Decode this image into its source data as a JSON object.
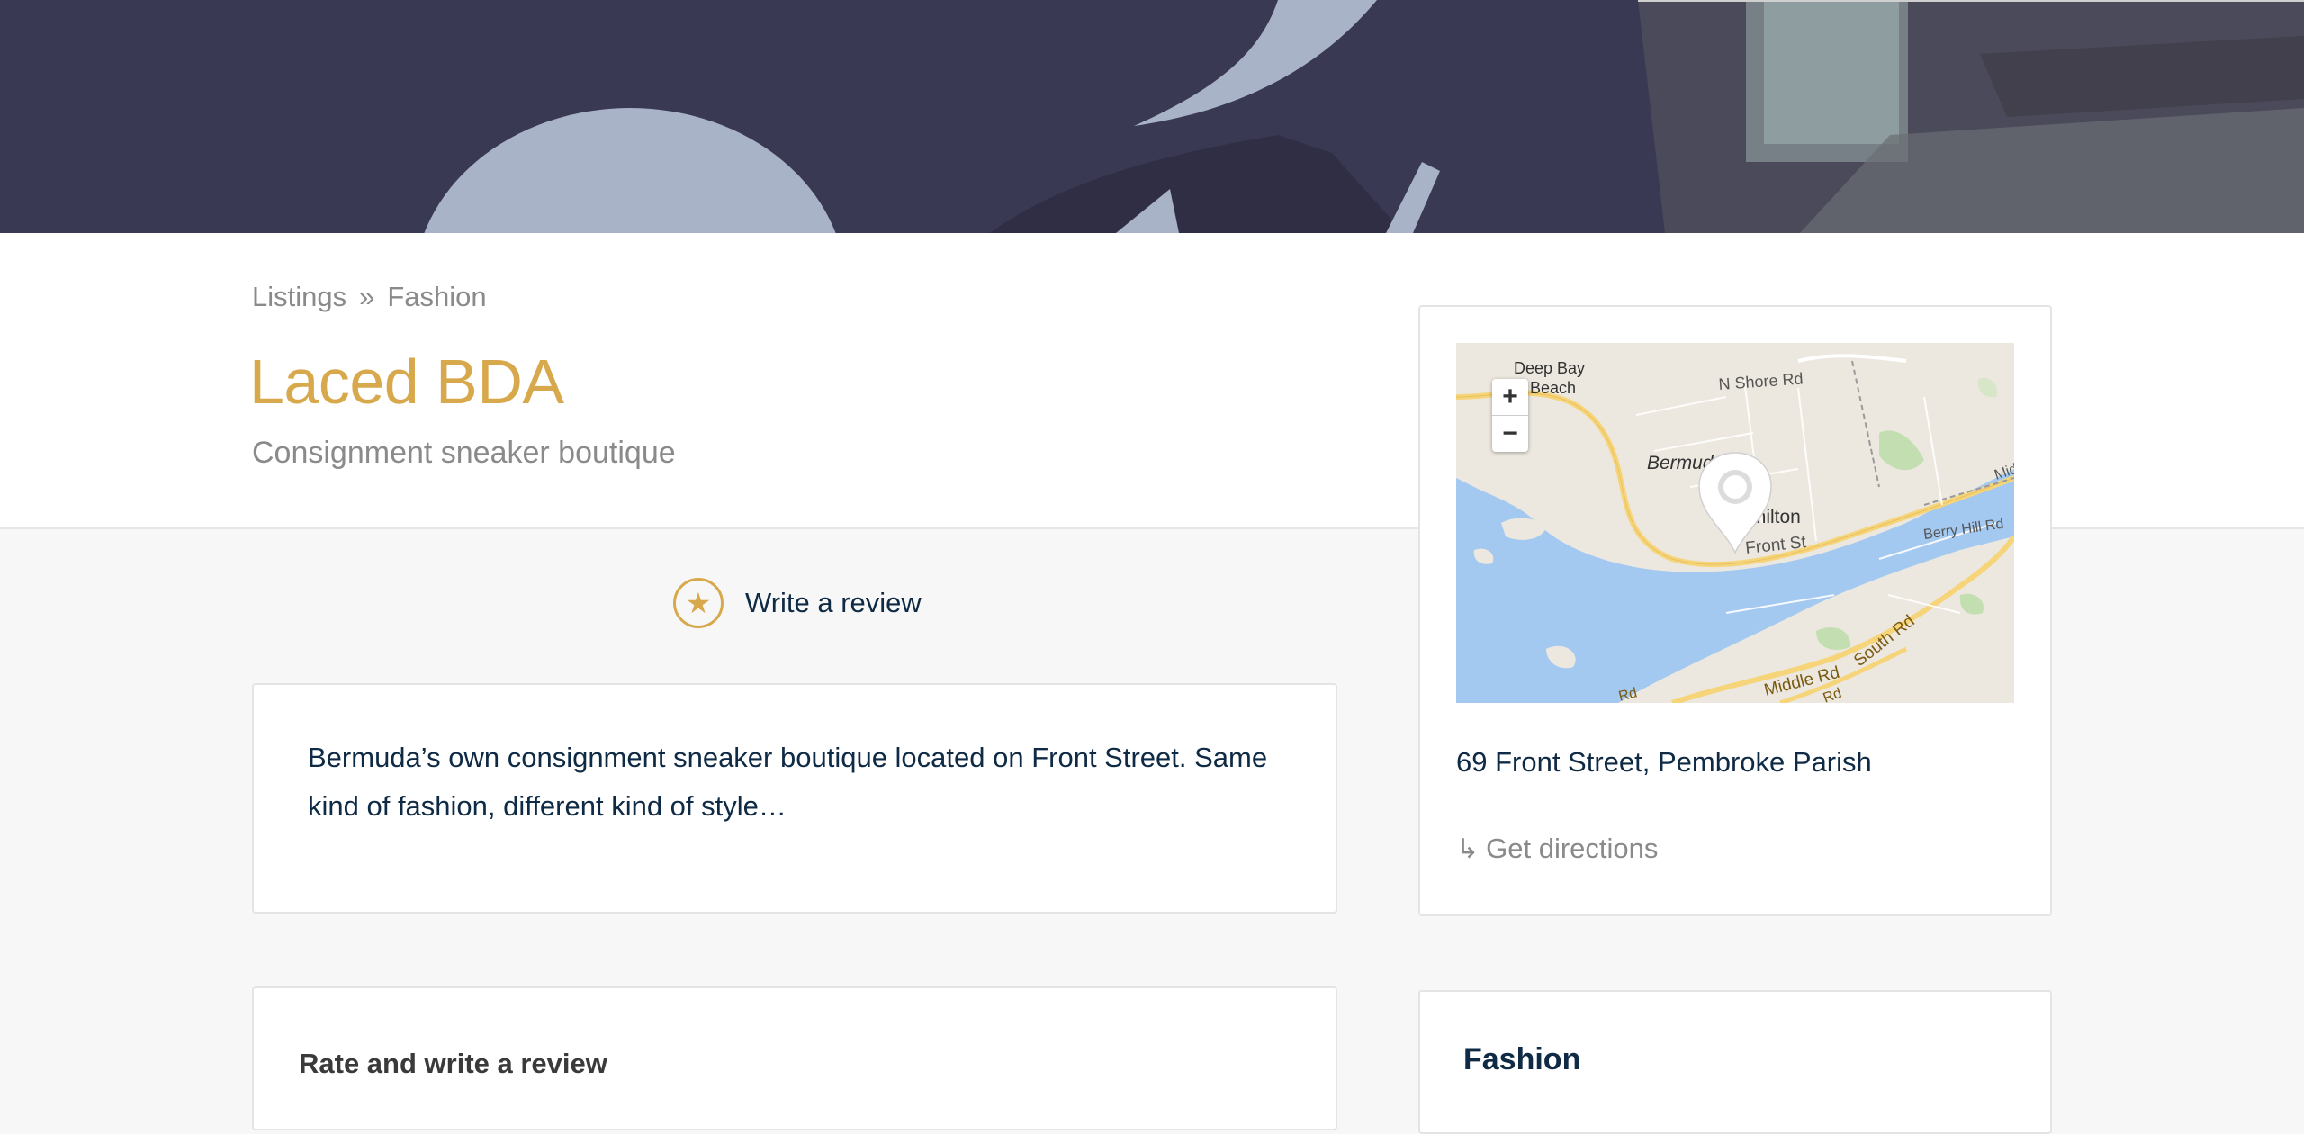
{
  "hero": {
    "image_desc": "blurred photo banner"
  },
  "breadcrumb": {
    "items": [
      "Listings",
      "Fashion"
    ],
    "separator": "»"
  },
  "listing": {
    "title": "Laced BDA",
    "subtitle": "Consignment sneaker boutique",
    "description": "Bermuda’s own consignment sneaker boutique located on Front Street. Same kind of fashion, different kind of style…"
  },
  "review": {
    "write_label": "Write a review",
    "rate_title": "Rate and write a review"
  },
  "map": {
    "zoom_in": "+",
    "zoom_out": "−",
    "labels": {
      "deep_bay": "Deep Bay",
      "beach": "Beach",
      "n_shore": "N Shore Rd",
      "bermuda": "Bermuda",
      "hamilton": "Hamilton",
      "front_st": "Front St",
      "berry_hill": "Berry Hill Rd",
      "south_rd": "South Rd",
      "middle_rd": "Middle Rd",
      "mid": "Mid",
      "rd1": "Rd",
      "rd2": "Rd"
    },
    "address": "69 Front Street, Pembroke Parish",
    "directions_label": "Get directions",
    "directions_arrow": "↳"
  },
  "category": {
    "title": "Fashion"
  },
  "colors": {
    "accent": "#d8a94c",
    "text_dark": "#0f2a44",
    "muted": "#8a8a8a",
    "water": "#a3c9f1",
    "land": "#ece8df",
    "road": "#f6d57a"
  }
}
